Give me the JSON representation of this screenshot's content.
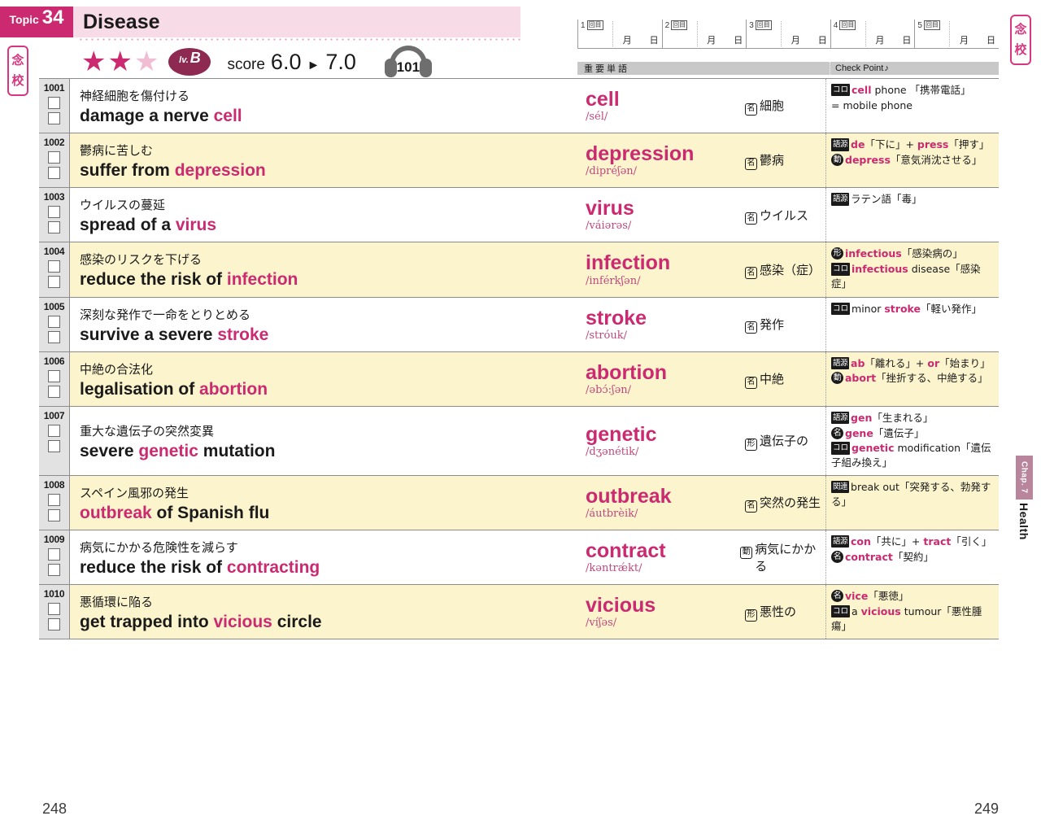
{
  "proof_tabs": {
    "label": "念校"
  },
  "chapter_tab": {
    "chapter": "Chap. 7",
    "name": "Health"
  },
  "topic": {
    "label": "Topic",
    "number": "34",
    "title": "Disease",
    "stars_filled": 2,
    "stars_total": 3,
    "level_prefix": "lv.",
    "level_value": "B",
    "score_label": "score",
    "score_from": "6.0",
    "score_arrow": "►",
    "score_to": "7.0",
    "audio_track": "101",
    "accent_color": "#cc2a70"
  },
  "study_log": {
    "cells": [
      {
        "n": "1",
        "kai": "回目",
        "month": "月",
        "day": "日"
      },
      {
        "n": "2",
        "kai": "回目",
        "month": "月",
        "day": "日"
      },
      {
        "n": "3",
        "kai": "回目",
        "month": "月",
        "day": "日"
      },
      {
        "n": "4",
        "kai": "回目",
        "month": "月",
        "day": "日"
      },
      {
        "n": "5",
        "kai": "回目",
        "month": "月",
        "day": "日"
      }
    ]
  },
  "column_headers": {
    "words": "重要単語",
    "check_point": "Check Point",
    "check_point_note": "♪"
  },
  "rows": [
    {
      "id": "1001",
      "shaded": false,
      "ja": "神経細胞を傷付ける",
      "en_pre": "damage a nerve ",
      "en_key": "cell",
      "en_post": "",
      "word": "cell",
      "ipa": "/sél/",
      "pos": "名",
      "definition": "細胞",
      "check": [
        {
          "tag": "コロ",
          "tag_style": "coll",
          "parts": [
            {
              "t": "cell",
              "hl": true
            },
            {
              "t": " phone 「携帯電話」",
              "hl": false
            }
          ]
        },
        {
          "tag": "",
          "tag_style": "",
          "parts": [
            {
              "t": "= mobile phone",
              "hl": false
            }
          ]
        }
      ]
    },
    {
      "id": "1002",
      "shaded": true,
      "ja": "鬱病に苦しむ",
      "en_pre": "suffer from ",
      "en_key": "depression",
      "en_post": "",
      "word": "depression",
      "ipa": "/dipréʃən/",
      "pos": "名",
      "definition": "鬱病",
      "check": [
        {
          "tag": "語源",
          "tag_style": "",
          "parts": [
            {
              "t": "de",
              "hl": true
            },
            {
              "t": "「下に」+ ",
              "hl": false
            },
            {
              "t": "press",
              "hl": true
            },
            {
              "t": "「押す」",
              "hl": false
            }
          ]
        },
        {
          "tag": "動",
          "tag_style": "pos-round",
          "parts": [
            {
              "t": "depress",
              "hl": true
            },
            {
              "t": "「意気消沈させる」",
              "hl": false
            }
          ]
        }
      ]
    },
    {
      "id": "1003",
      "shaded": false,
      "ja": "ウイルスの蔓延",
      "en_pre": "spread of a ",
      "en_key": "virus",
      "en_post": "",
      "word": "virus",
      "ipa": "/váiərəs/",
      "pos": "名",
      "definition": "ウイルス",
      "check": [
        {
          "tag": "語源",
          "tag_style": "",
          "parts": [
            {
              "t": "ラテン語「毒」",
              "hl": false
            }
          ]
        }
      ]
    },
    {
      "id": "1004",
      "shaded": true,
      "ja": "感染のリスクを下げる",
      "en_pre": "reduce the risk of ",
      "en_key": "infection",
      "en_post": "",
      "word": "infection",
      "ipa": "/inférkʃən/",
      "pos": "名",
      "definition": "感染（症）",
      "check": [
        {
          "tag": "形",
          "tag_style": "pos-round",
          "parts": [
            {
              "t": "infectious",
              "hl": true
            },
            {
              "t": "「感染病の」",
              "hl": false
            }
          ]
        },
        {
          "tag": "コロ",
          "tag_style": "coll",
          "parts": [
            {
              "t": "infectious",
              "hl": true
            },
            {
              "t": " disease「感染症」",
              "hl": false
            }
          ]
        }
      ]
    },
    {
      "id": "1005",
      "shaded": false,
      "ja": "深刻な発作で一命をとりとめる",
      "en_pre": "survive a severe ",
      "en_key": "stroke",
      "en_post": "",
      "word": "stroke",
      "ipa": "/stróuk/",
      "pos": "名",
      "definition": "発作",
      "check": [
        {
          "tag": "コロ",
          "tag_style": "coll",
          "parts": [
            {
              "t": "minor ",
              "hl": false
            },
            {
              "t": "stroke",
              "hl": true
            },
            {
              "t": "「軽い発作」",
              "hl": false
            }
          ]
        }
      ]
    },
    {
      "id": "1006",
      "shaded": true,
      "ja": "中絶の合法化",
      "en_pre": "legalisation of ",
      "en_key": "abortion",
      "en_post": "",
      "word": "abortion",
      "ipa": "/əbɔ́:ʃən/",
      "pos": "名",
      "definition": "中絶",
      "check": [
        {
          "tag": "語源",
          "tag_style": "",
          "parts": [
            {
              "t": "ab",
              "hl": true
            },
            {
              "t": "「離れる」+ ",
              "hl": false
            },
            {
              "t": "or",
              "hl": true
            },
            {
              "t": "「始まり」",
              "hl": false
            }
          ]
        },
        {
          "tag": "動",
          "tag_style": "pos-round",
          "parts": [
            {
              "t": "abort",
              "hl": true
            },
            {
              "t": "「挫折する、中絶する」",
              "hl": false
            }
          ]
        }
      ]
    },
    {
      "id": "1007",
      "shaded": false,
      "ja": "重大な遺伝子の突然変異",
      "en_pre": "severe ",
      "en_key": "genetic",
      "en_post": " mutation",
      "word": "genetic",
      "ipa": "/dʒənétik/",
      "pos": "形",
      "definition": "遺伝子の",
      "check": [
        {
          "tag": "語源",
          "tag_style": "",
          "parts": [
            {
              "t": "gen",
              "hl": true
            },
            {
              "t": "「生まれる」",
              "hl": false
            }
          ]
        },
        {
          "tag": "名",
          "tag_style": "pos-round",
          "parts": [
            {
              "t": "gene",
              "hl": true
            },
            {
              "t": "「遺伝子」",
              "hl": false
            }
          ]
        },
        {
          "tag": "コロ",
          "tag_style": "coll",
          "parts": [
            {
              "t": "genetic",
              "hl": true
            },
            {
              "t": " modification「遺伝子組み換え」",
              "hl": false
            }
          ]
        }
      ]
    },
    {
      "id": "1008",
      "shaded": true,
      "ja": "スペイン風邪の発生",
      "en_pre": "",
      "en_key": "outbreak",
      "en_post": " of Spanish flu",
      "word": "outbreak",
      "ipa": "/áutbrèik/",
      "pos": "名",
      "definition": "突然の発生",
      "check": [
        {
          "tag": "関連",
          "tag_style": "",
          "parts": [
            {
              "t": "break out「突発する、勃発する」",
              "hl": false
            }
          ]
        }
      ]
    },
    {
      "id": "1009",
      "shaded": false,
      "ja": "病気にかかる危険性を減らす",
      "en_pre": "reduce the risk of ",
      "en_key": "contracting",
      "en_post": "",
      "word": "contract",
      "ipa": "/kəntrǽkt/",
      "pos": "動",
      "definition": "病気にかかる",
      "check": [
        {
          "tag": "語源",
          "tag_style": "",
          "parts": [
            {
              "t": "con",
              "hl": true
            },
            {
              "t": "「共に」+ ",
              "hl": false
            },
            {
              "t": "tract",
              "hl": true
            },
            {
              "t": "「引く」",
              "hl": false
            }
          ]
        },
        {
          "tag": "名",
          "tag_style": "pos-round",
          "parts": [
            {
              "t": "contract",
              "hl": true
            },
            {
              "t": "「契約」",
              "hl": false
            }
          ]
        }
      ]
    },
    {
      "id": "1010",
      "shaded": true,
      "ja": "悪循環に陥る",
      "en_pre": "get trapped into ",
      "en_key": "vicious",
      "en_post": " circle",
      "word": "vicious",
      "ipa": "/víʃəs/",
      "pos": "形",
      "definition": "悪性の",
      "check": [
        {
          "tag": "名",
          "tag_style": "pos-round",
          "parts": [
            {
              "t": "vice",
              "hl": true
            },
            {
              "t": "「悪徳」",
              "hl": false
            }
          ]
        },
        {
          "tag": "コロ",
          "tag_style": "coll",
          "parts": [
            {
              "t": "a ",
              "hl": false
            },
            {
              "t": "vicious",
              "hl": true
            },
            {
              "t": " tumour「悪性腫瘍」",
              "hl": false
            }
          ]
        }
      ]
    }
  ],
  "footer": {
    "page_left": "248",
    "page_right": "249"
  }
}
